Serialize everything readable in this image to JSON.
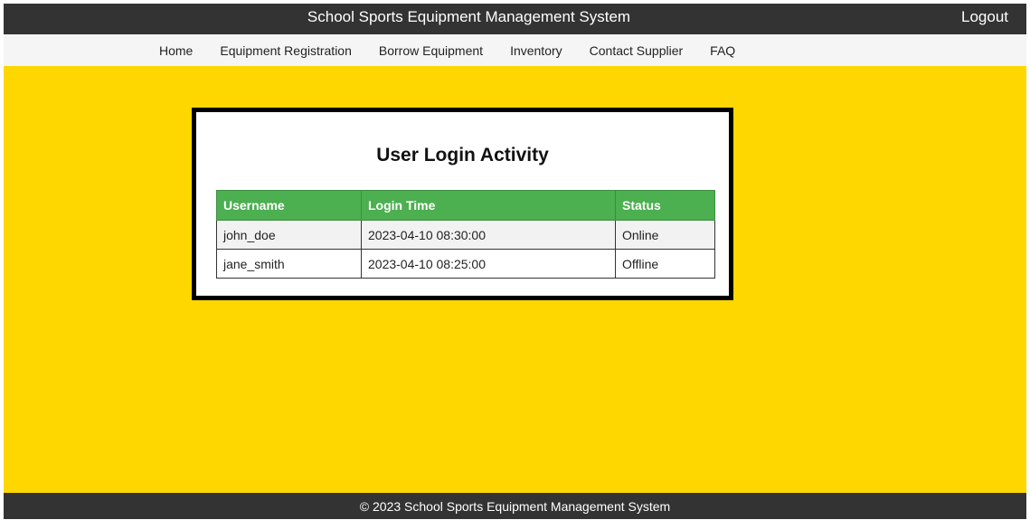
{
  "header": {
    "title": "School Sports Equipment Management System",
    "logout_label": "Logout"
  },
  "nav": {
    "items": [
      {
        "label": "Home"
      },
      {
        "label": "Equipment Registration"
      },
      {
        "label": "Borrow Equipment"
      },
      {
        "label": "Inventory"
      },
      {
        "label": "Contact Supplier"
      },
      {
        "label": "FAQ"
      }
    ]
  },
  "activity": {
    "title": "User Login Activity",
    "columns": [
      "Username",
      "Login Time",
      "Status"
    ],
    "rows": [
      {
        "username": "john_doe",
        "login_time": "2023-04-10 08:30:00",
        "status": "Online"
      },
      {
        "username": "jane_smith",
        "login_time": "2023-04-10 08:25:00",
        "status": "Offline"
      }
    ]
  },
  "footer": {
    "text": "© 2023 School Sports Equipment Management System"
  },
  "colors": {
    "page_background": "#ffd700",
    "bar_background": "#333333",
    "table_header": "#4caf50"
  }
}
